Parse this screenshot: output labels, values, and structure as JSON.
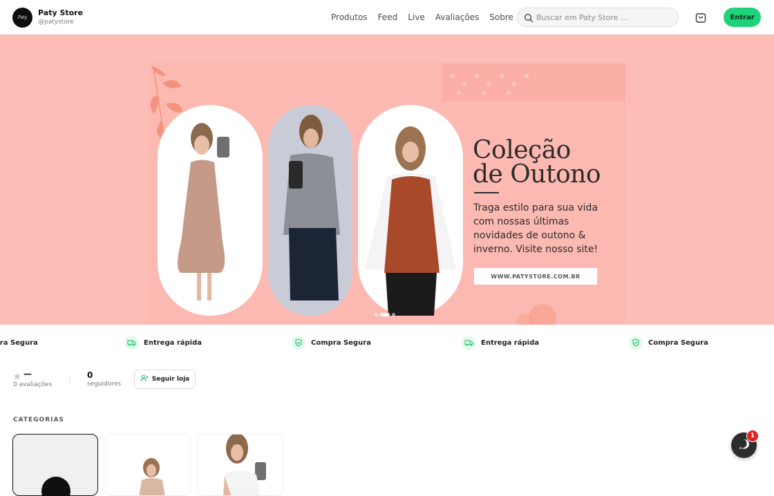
{
  "header": {
    "logo_text": "Paty",
    "store_name": "Paty Store",
    "store_handle": "@patystore",
    "nav": [
      "Produtos",
      "Feed",
      "Live",
      "Avaliações",
      "Sobre"
    ],
    "search_placeholder": "Buscar em Paty Store ...",
    "login_label": "Entrar",
    "cart_icon": "shopping-bag-icon"
  },
  "banner": {
    "title": "Coleção\nde Outono",
    "text": "Traga estilo para sua vida com nossas últimas novidades de outono & inverno. Visite nosso site!",
    "url": "WWW.PATYSTORE.COM.BR",
    "background_color": "#fdbdb7",
    "slides": 3,
    "active_slide": 1
  },
  "marquee": {
    "items": [
      {
        "label": "Compra Segura",
        "icon": "shield-check-icon"
      },
      {
        "label": "Entrega rápida",
        "icon": "truck-icon"
      },
      {
        "label": "Compra Segura",
        "icon": "shield-check-icon"
      },
      {
        "label": "Entrega rápida",
        "icon": "truck-icon"
      },
      {
        "label": "Compra Segura",
        "icon": "shield-check-icon"
      }
    ],
    "accent_color": "#1ed37a"
  },
  "stats": {
    "rating_value": "—",
    "rating_label": "0 avaliações",
    "followers_value": "0",
    "followers_label": "seguidores",
    "follow_button": "Seguir loja"
  },
  "categories": {
    "title": "CATEGORIAS",
    "items": [
      {
        "selected": true
      },
      {
        "selected": false
      },
      {
        "selected": false
      }
    ]
  },
  "chat": {
    "badge": "1",
    "icon": "whatsapp-icon"
  }
}
